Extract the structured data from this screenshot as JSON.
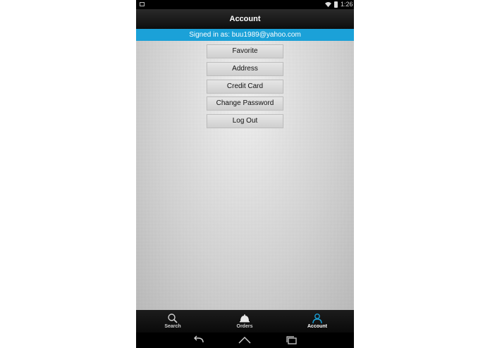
{
  "status_bar": {
    "time": "1:26",
    "icons": [
      "notification-icon",
      "wifi-icon",
      "battery-icon"
    ]
  },
  "action_bar": {
    "title": "Account"
  },
  "account": {
    "signed_in_text": "Signed in as: buu1989@yahoo.com"
  },
  "menu": {
    "items": [
      {
        "label": "Favorite"
      },
      {
        "label": "Address"
      },
      {
        "label": "Credit Card"
      },
      {
        "label": "Change Password"
      },
      {
        "label": "Log Out"
      }
    ]
  },
  "bottom_nav": {
    "items": [
      {
        "label": "Search",
        "icon": "search-icon"
      },
      {
        "label": "Orders",
        "icon": "cloche-icon"
      },
      {
        "label": "Account",
        "icon": "person-icon",
        "active": true
      }
    ]
  },
  "system_nav": {
    "buttons": [
      "back-icon",
      "home-icon",
      "recents-icon"
    ]
  },
  "colors": {
    "accent": "#1ba1d8",
    "action_bar": "#1a1a1a",
    "button_bg": "#dcdcdc"
  }
}
